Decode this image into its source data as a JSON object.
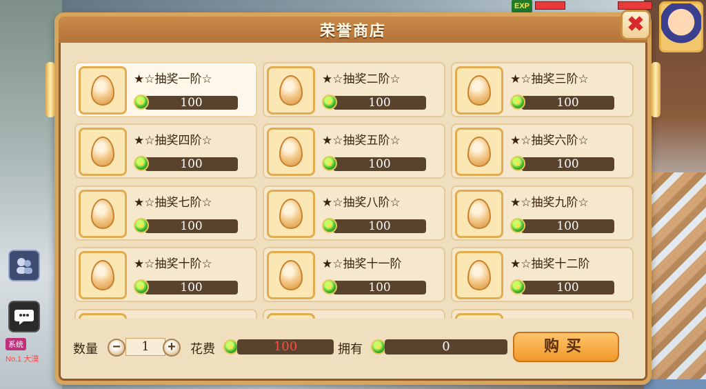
{
  "window": {
    "title": "荣誉商店",
    "close_symbol": "✖"
  },
  "hud": {
    "exp_label": "EXP",
    "system_tag": "系统",
    "rank_text": "No.1 大漠"
  },
  "items": [
    {
      "name": "★☆抽奖一阶☆",
      "price": "100"
    },
    {
      "name": "★☆抽奖二阶☆",
      "price": "100"
    },
    {
      "name": "★☆抽奖三阶☆",
      "price": "100"
    },
    {
      "name": "★☆抽奖四阶☆",
      "price": "100"
    },
    {
      "name": "★☆抽奖五阶☆",
      "price": "100"
    },
    {
      "name": "★☆抽奖六阶☆",
      "price": "100"
    },
    {
      "name": "★☆抽奖七阶☆",
      "price": "100"
    },
    {
      "name": "★☆抽奖八阶☆",
      "price": "100"
    },
    {
      "name": "★☆抽奖九阶☆",
      "price": "100"
    },
    {
      "name": "★☆抽奖十阶☆",
      "price": "100"
    },
    {
      "name": "★☆抽奖十一阶",
      "price": "100"
    },
    {
      "name": "★☆抽奖十二阶",
      "price": "100"
    },
    {
      "name": "",
      "price": ""
    },
    {
      "name": "",
      "price": ""
    },
    {
      "name": "",
      "price": ""
    }
  ],
  "purchase": {
    "quantity_label": "数量",
    "quantity": "1",
    "minus": "−",
    "plus": "+",
    "cost_label": "花费",
    "cost": "100",
    "owned_label": "拥有",
    "owned": "0",
    "buy_label": "购买"
  },
  "colors": {
    "accent": "#d9a55c",
    "price_bar": "#5a432c",
    "cost_text": "#ff4a4a"
  }
}
